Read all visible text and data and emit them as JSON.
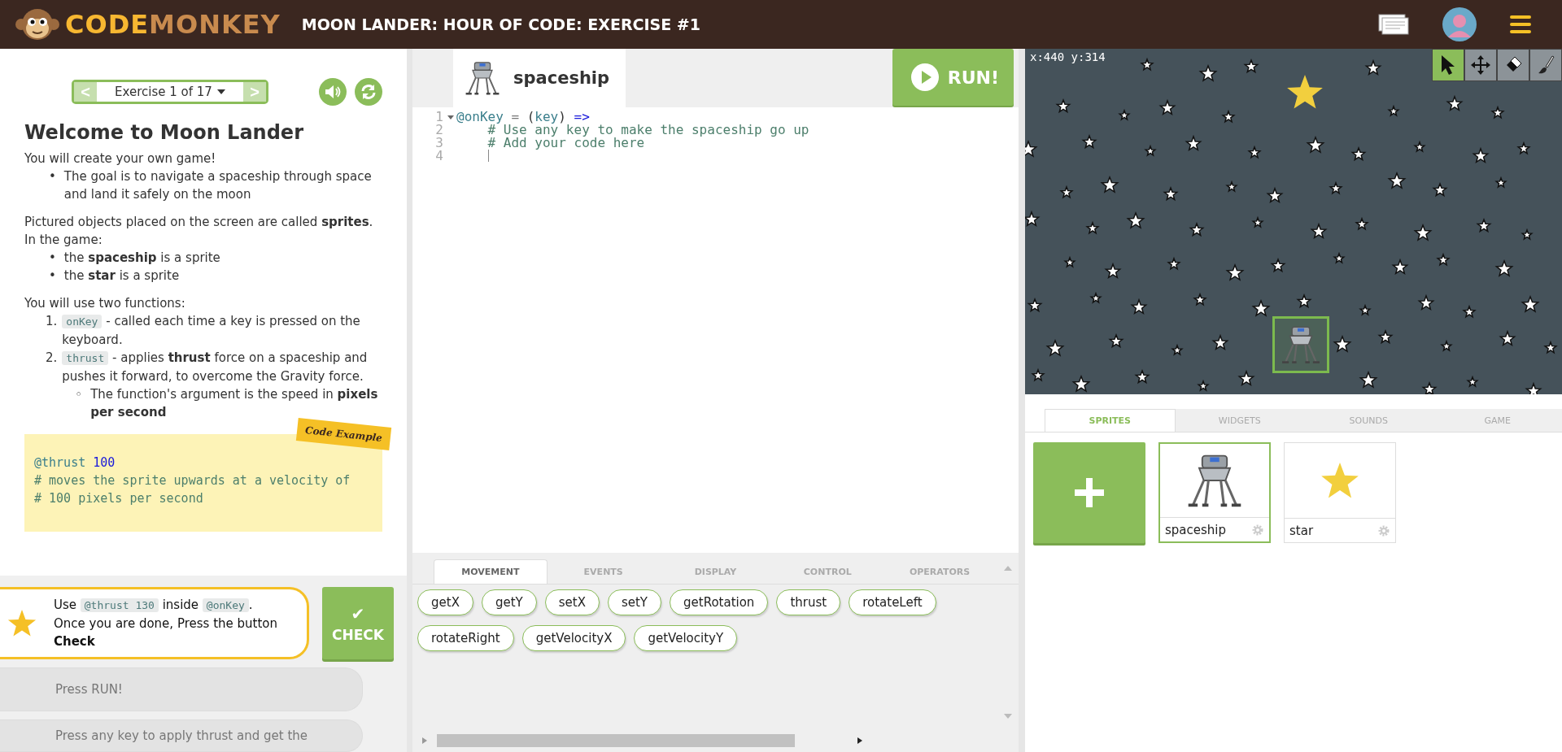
{
  "header": {
    "logo": {
      "first": "CODE",
      "second": "MONKEY"
    },
    "title": "MOON LANDER: HOUR OF CODE: EXERCISE #1"
  },
  "instructions": {
    "exercise_nav": {
      "prev": "<",
      "label": "Exercise 1 of 17",
      "next": ">"
    },
    "title": "Welcome to Moon Lander",
    "intro": "You will create your own game!",
    "intro_bullets": [
      {
        "marker": "•",
        "text": "The goal is to navigate a spaceship through space and land it safely on the moon"
      }
    ],
    "sprites_text": "Pictured objects placed on the screen are called **sprites**. In the game:",
    "sprite_bullets": [
      {
        "marker": "•",
        "text": "the **spaceship** is a sprite"
      },
      {
        "marker": "•",
        "text": "the **star** is a sprite"
      }
    ],
    "functions_text": "You will use two functions:",
    "functions": [
      {
        "number": "1.",
        "code": "onKey",
        "text": "- called each time a key is pressed on the keyboard."
      },
      {
        "number": "2.",
        "code": "thrust",
        "text": "- applies **thrust** force on a spaceship and pushes it forward, to overcome the Gravity force.",
        "sub": [
          {
            "marker": "◦",
            "text": "The function's argument is the speed in **pixels per second**"
          }
        ]
      }
    ],
    "code_example": {
      "ribbon": "Code Example",
      "lines": [
        [
          {
            "kind": "var",
            "text": "@thrust"
          },
          {
            "kind": "number",
            "text": "100"
          }
        ],
        [
          {
            "kind": "comment",
            "text": "# moves the sprite upwards at a velocity of"
          }
        ],
        [
          {
            "kind": "comment",
            "text": "# 100 pixels per second"
          }
        ]
      ]
    }
  },
  "steps": {
    "current": {
      "parts": [
        {
          "kind": "text",
          "text": "Use "
        },
        {
          "kind": "code",
          "text": "@thrust 130"
        },
        {
          "kind": "text",
          "text": " inside "
        },
        {
          "kind": "code",
          "text": "@onKey"
        },
        {
          "kind": "text",
          "text": "."
        }
      ],
      "line2": "Once you are done, Press the button",
      "line3": "Check"
    },
    "check_button": {
      "icon": "✔",
      "label": "CHECK"
    },
    "upcoming": [
      "Press RUN!",
      "Press any key to apply thrust and get the"
    ]
  },
  "editor": {
    "sprite_tab": {
      "label": "spaceship"
    },
    "run_button": "RUN!",
    "lines": [
      {
        "number": "1",
        "fold": true,
        "indented": false,
        "tokens": [
          {
            "kind": "var",
            "text": "@onKey"
          },
          {
            "kind": "op",
            "text": " = "
          },
          {
            "kind": "plain",
            "text": "("
          },
          {
            "kind": "var",
            "text": "key"
          },
          {
            "kind": "plain",
            "text": ")"
          },
          {
            "kind": "keyword",
            "text": " =>"
          }
        ]
      },
      {
        "number": "2",
        "fold": false,
        "indented": true,
        "tokens": [
          {
            "kind": "comment",
            "text": "# Use any key to make the spaceship go up"
          }
        ]
      },
      {
        "number": "3",
        "fold": false,
        "indented": true,
        "tokens": [
          {
            "kind": "comment",
            "text": "# Add your code here"
          }
        ]
      },
      {
        "number": "4",
        "fold": false,
        "indented": true,
        "tokens": [
          {
            "kind": "cursor"
          }
        ]
      }
    ]
  },
  "palette": {
    "tabs": [
      {
        "label": "MOVEMENT",
        "selected": true
      },
      {
        "label": "EVENTS",
        "selected": false
      },
      {
        "label": "DISPLAY",
        "selected": false
      },
      {
        "label": "CONTROL",
        "selected": false
      },
      {
        "label": "OPERATORS",
        "selected": false
      }
    ],
    "blocks": [
      "getX",
      "getY",
      "setX",
      "setY",
      "getRotation",
      "thrust",
      "rotateLeft",
      "rotateRight",
      "getVelocityX",
      "getVelocityY"
    ]
  },
  "stage": {
    "coords": "x:440 y:314",
    "tools": [
      {
        "kind": "pointer",
        "selected": true
      },
      {
        "kind": "move",
        "selected": false
      },
      {
        "kind": "eraser",
        "selected": false
      },
      {
        "kind": "brush",
        "selected": false
      }
    ],
    "sprites_on_stage": [
      {
        "kind": "star",
        "selected": false
      },
      {
        "kind": "spaceship",
        "selected": true
      }
    ]
  },
  "assets": {
    "tabs": [
      {
        "label": "SPRITES",
        "selected": true
      },
      {
        "label": "WIDGETS",
        "selected": false
      },
      {
        "label": "SOUNDS",
        "selected": false
      },
      {
        "label": "GAME",
        "selected": false
      }
    ],
    "sprites": [
      {
        "kind": "spaceship",
        "name": "spaceship",
        "selected": true
      },
      {
        "kind": "star",
        "name": "star",
        "selected": false
      }
    ]
  }
}
